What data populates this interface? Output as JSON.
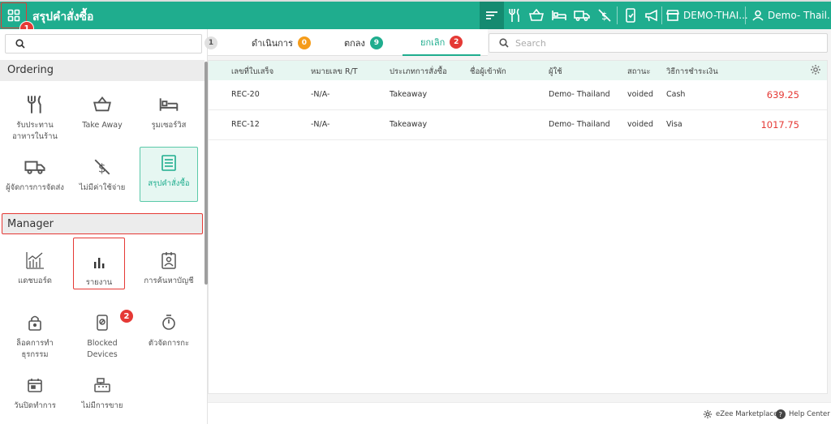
{
  "header": {
    "title": "สรุปคำสั่งซื้อ",
    "store": "DEMO-THAI...",
    "user": "Demo- Thail..."
  },
  "steps": {
    "one": "1",
    "two": "2"
  },
  "sidebar": {
    "search_placeholder": "",
    "ordering_title": "Ordering",
    "ordering_items": [
      {
        "label": "รับประทานอาหารในร้าน",
        "icon": "dine-in-icon"
      },
      {
        "label": "Take Away",
        "icon": "basket-icon"
      },
      {
        "label": "รูมเซอร์วิส",
        "icon": "bed-icon"
      },
      {
        "label": "ผู้จัดการการจัดส่ง",
        "icon": "truck-icon"
      },
      {
        "label": "ไม่มีค่าใช้จ่าย",
        "icon": "no-charge-icon"
      },
      {
        "label": "สรุปคำสั่งซื้อ",
        "icon": "order-summary-icon"
      }
    ],
    "manager_title": "Manager",
    "manager_items": [
      {
        "label": "แดชบอร์ด",
        "icon": "dashboard-icon"
      },
      {
        "label": "รายงาน",
        "icon": "report-icon"
      },
      {
        "label": "การค้นหาบัญชี",
        "icon": "account-search-icon"
      },
      {
        "label": "ล็อคการทำธุรกรรม",
        "icon": "lock-icon"
      },
      {
        "label": "Blocked Devices",
        "icon": "blocked-device-icon"
      },
      {
        "label": "ตัวจัดการกะ",
        "icon": "timer-icon"
      },
      {
        "label": "วันปิดทำการ",
        "icon": "calendar-icon"
      },
      {
        "label": "ไม่มีการขาย",
        "icon": "no-sale-icon"
      }
    ]
  },
  "tabs": [
    {
      "label": "ดำเนินการ",
      "count": "0",
      "color": "#f59c1a"
    },
    {
      "label": "ตกลง",
      "count": "9",
      "color": "#1fad8e"
    },
    {
      "label": "ยกเลิก",
      "count": "2",
      "color": "#e53935"
    }
  ],
  "tab_partial_count": "1",
  "search": {
    "placeholder": "Search"
  },
  "table": {
    "columns": [
      "เลขที่ใบเสร็จ",
      "หมายเลข R/T",
      "ประเภทการสั่งซื้อ",
      "ชื่อผู้เข้าพัก",
      "ผู้ใช้",
      "สถานะ",
      "วิธีการชำระเงิน"
    ],
    "rows": [
      {
        "receipt": "REC-20",
        "rt": "-N/A-",
        "type": "Takeaway",
        "guest": "",
        "user": "Demo- Thailand",
        "status": "voided",
        "payment": "Cash",
        "amount": "639.25"
      },
      {
        "receipt": "REC-12",
        "rt": "-N/A-",
        "type": "Takeaway",
        "guest": "",
        "user": "Demo- Thailand",
        "status": "voided",
        "payment": "Visa",
        "amount": "1017.75"
      }
    ]
  },
  "footer": {
    "marketplace": "eZee Marketplace",
    "help": "Help Center"
  },
  "colors": {
    "brand": "#1fad8e",
    "danger": "#e53935",
    "warning": "#f59c1a"
  }
}
